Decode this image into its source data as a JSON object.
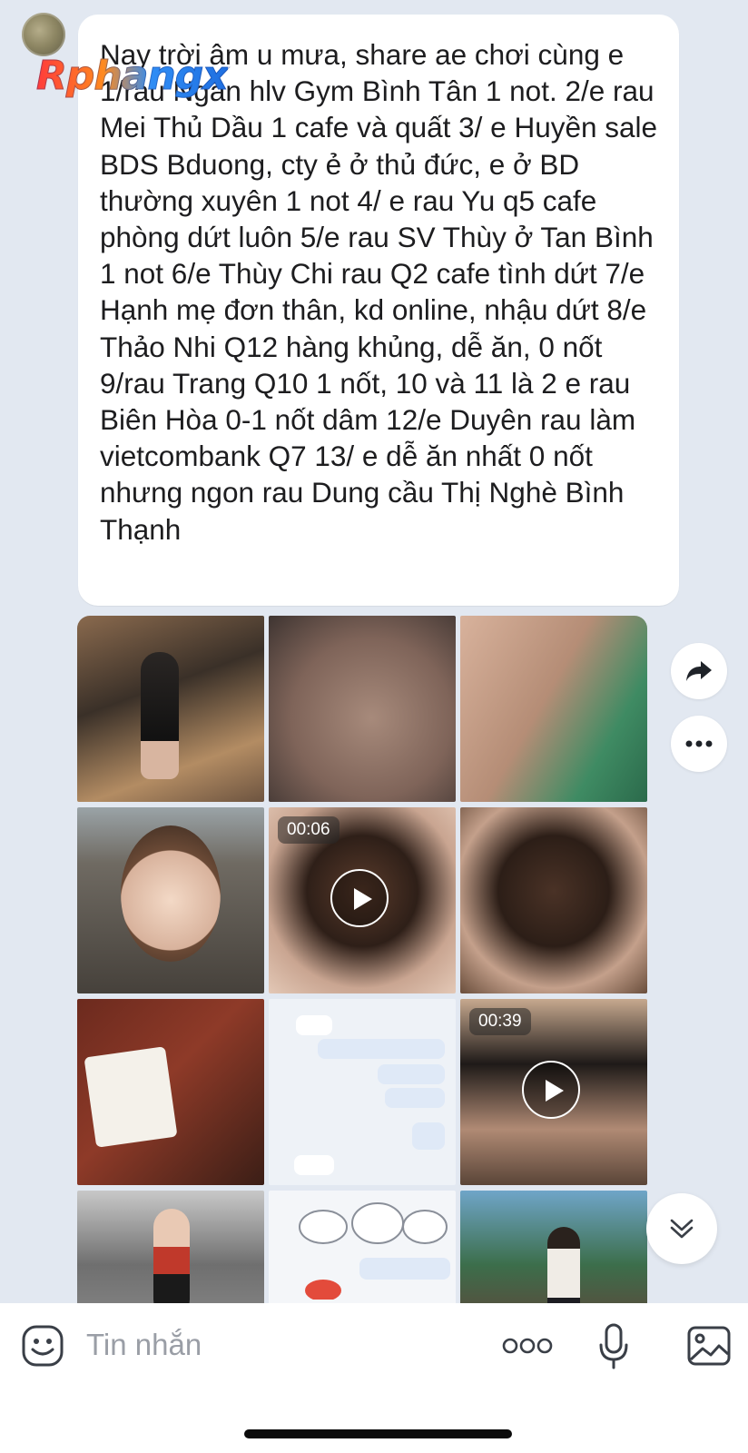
{
  "chat": {
    "watermark": "Rphangx",
    "message_text": "Nay trời âm u mưa, share ae chơi cùng e 1/rau Ngân hlv Gym Bình Tân 1 not. 2/e rau Mei Thủ Dầu 1 cafe và quất 3/ e Huyền sale BDS Bduong, cty ẻ ở thủ đức, e ở BD thường xuyên 1 not 4/ e rau Yu q5 cafe phòng dứt luôn 5/e rau SV Thùy ở Tan Bình 1 not 6/e Thùy Chi rau Q2 cafe tình dứt 7/e Hạnh mẹ đơn thân, kd online, nhậu dứt 8/e Thảo Nhi Q12 hàng khủng, dễ ăn, 0 nốt 9/rau Trang Q10 1 nốt, 10 và 11 là 2 e rau Biên Hòa 0-1 nốt dâm 12/e Duyên rau làm vietcombank Q7 13/ e dễ ăn nhất 0 nốt nhưng ngon rau Dung cầu Thị Nghè Bình Thạnh",
    "media": [
      {
        "kind": "photo"
      },
      {
        "kind": "photo"
      },
      {
        "kind": "photo"
      },
      {
        "kind": "photo"
      },
      {
        "kind": "video",
        "duration": "00:06"
      },
      {
        "kind": "photo"
      },
      {
        "kind": "photo"
      },
      {
        "kind": "screenshot"
      },
      {
        "kind": "video",
        "duration": "00:39"
      },
      {
        "kind": "photo"
      },
      {
        "kind": "screenshot"
      },
      {
        "kind": "photo"
      }
    ]
  },
  "composer": {
    "placeholder": "Tin nhắn",
    "icons": [
      "emoji-icon",
      "more-dots-icon",
      "microphone-icon",
      "image-icon"
    ]
  },
  "actions": {
    "icons": [
      "share-arrow-icon",
      "more-icon",
      "scroll-down-icon"
    ]
  },
  "colors": {
    "background": "#e2e8f1",
    "bubble": "#ffffff",
    "text": "#1d1d1f",
    "placeholder": "#9a9ea6",
    "icon": "#3a3f47"
  }
}
